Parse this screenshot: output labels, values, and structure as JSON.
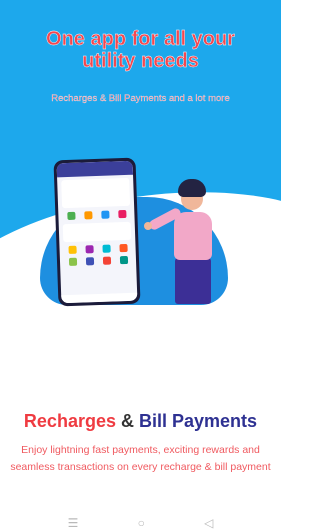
{
  "hero": {
    "title_line1": "One app for all your",
    "title_line2": "utility needs",
    "subtitle": "Recharges & Bill Payments and a lot more"
  },
  "headline": {
    "part1": "Recharges",
    "part2": "&",
    "part3": "Bill Payments"
  },
  "description": "Enjoy lightning fast payments, exciting rewards and seamless transactions on every recharge & bill payment",
  "navigation": {
    "icons": [
      "menu-icon",
      "home-circle-icon",
      "back-triangle-icon"
    ]
  },
  "colors": {
    "hero_background": "#1da8ec",
    "accent_red": "#ef3b41",
    "accent_blue": "#2e3192"
  }
}
